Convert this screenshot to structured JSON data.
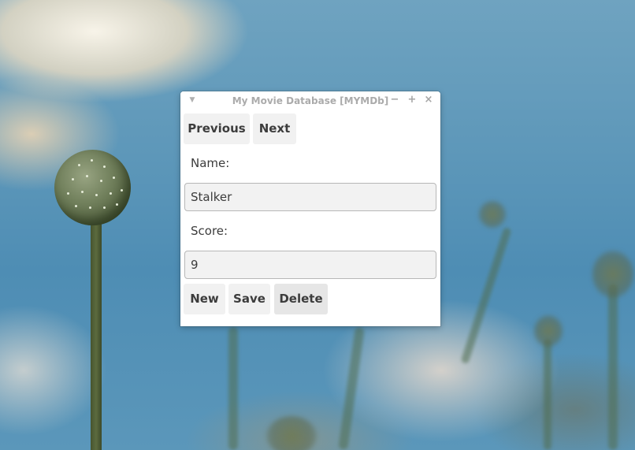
{
  "window": {
    "title": "My Movie Database [MYMDb]",
    "controls": {
      "menu_icon": "triangle-down-icon",
      "minimize_icon": "minimize-icon",
      "maximize_icon": "maximize-icon",
      "close_icon": "close-icon"
    }
  },
  "navigation": {
    "previous_label": "Previous",
    "next_label": "Next"
  },
  "form": {
    "name_label": "Name:",
    "name_value": "Stalker",
    "score_label": "Score:",
    "score_value": "9"
  },
  "actions": {
    "new_label": "New",
    "save_label": "Save",
    "delete_label": "Delete"
  },
  "colors": {
    "window_bg": "#ffffff",
    "button_bg": "#f1f1f1",
    "button_pressed_bg": "#e6e6e6",
    "field_bg": "#f2f2f2",
    "text": "#3c3c3c",
    "title_text": "#ababab"
  }
}
